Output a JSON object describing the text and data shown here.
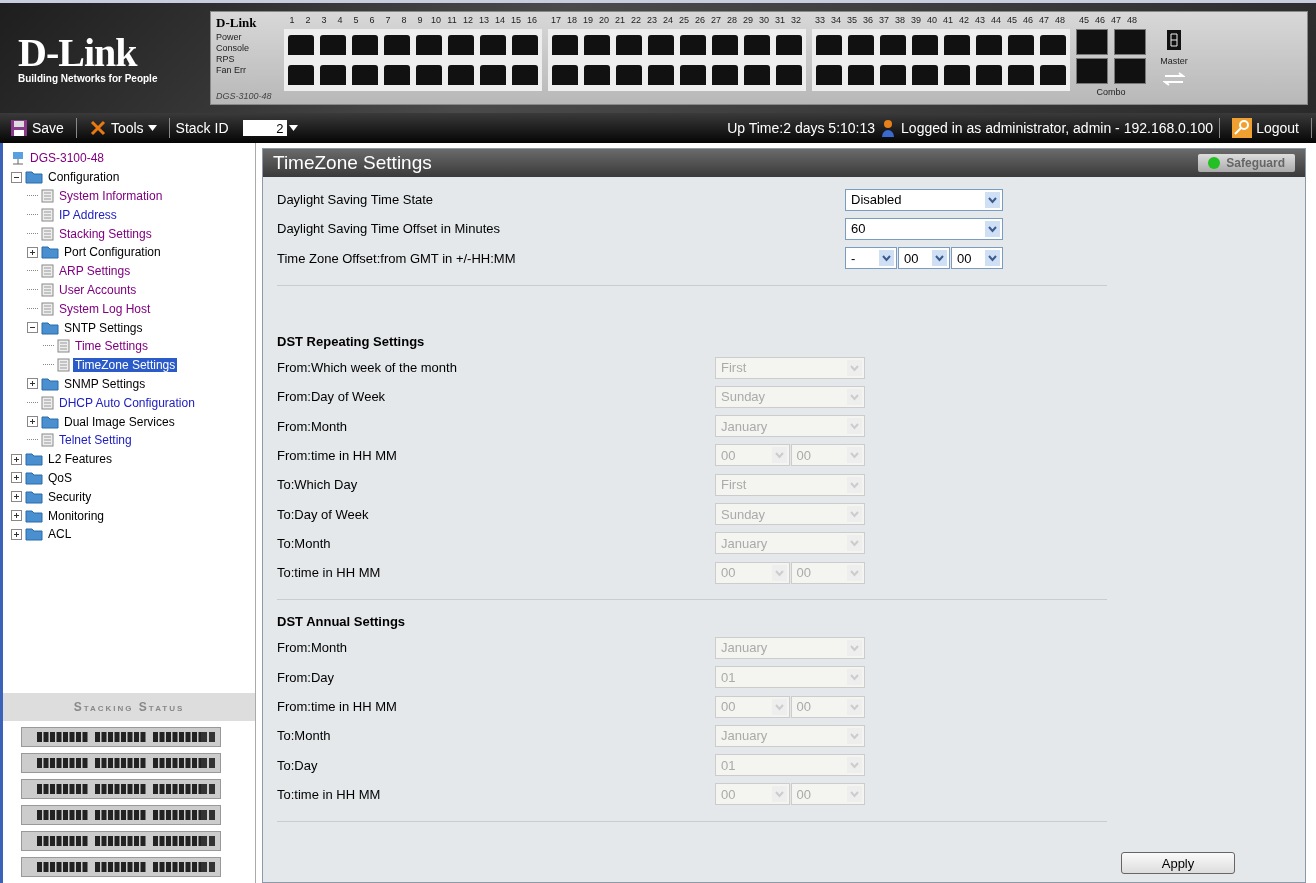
{
  "banner": {
    "logo": "D-Link",
    "tagline": "Building Networks for People",
    "device": {
      "brand": "D-Link",
      "model": "DGS-3100-48",
      "leds": [
        "Power",
        "Console",
        "RPS",
        "Fan Err"
      ],
      "ports": [
        "1",
        "2",
        "3",
        "4",
        "5",
        "6",
        "7",
        "8",
        "9",
        "10",
        "11",
        "12",
        "13",
        "14",
        "15",
        "16",
        "17",
        "18",
        "19",
        "20",
        "21",
        "22",
        "23",
        "24",
        "25",
        "26",
        "27",
        "28",
        "29",
        "30",
        "31",
        "32",
        "33",
        "34",
        "35",
        "36",
        "37",
        "38",
        "39",
        "40",
        "41",
        "42",
        "43",
        "44",
        "45",
        "46",
        "47",
        "48"
      ],
      "combo_ports": [
        "45",
        "46",
        "47",
        "48"
      ],
      "combo_label": "Combo",
      "master_label": "Master"
    }
  },
  "toolbar": {
    "save": "Save",
    "tools": "Tools",
    "stack_id_label": "Stack ID",
    "stack_id": "2",
    "uptime": "Up Time:2 days 5:10:13",
    "login": "Logged in as administrator, admin - 192.168.0.100",
    "logout": "Logout"
  },
  "tree": {
    "root": "DGS-3100-48",
    "items": [
      {
        "label": "Configuration",
        "kind": "folder",
        "expanded": true,
        "children": [
          {
            "label": "System Information",
            "kind": "page",
            "visited": true,
            "selected": false
          },
          {
            "label": "IP Address",
            "kind": "page",
            "visited": false,
            "selected": false
          },
          {
            "label": "Stacking Settings",
            "kind": "page",
            "visited": true,
            "selected": false
          },
          {
            "label": "Port Configuration",
            "kind": "folder",
            "expanded": false
          },
          {
            "label": "ARP Settings",
            "kind": "page",
            "visited": true,
            "selected": false
          },
          {
            "label": "User Accounts",
            "kind": "page",
            "visited": true,
            "selected": false
          },
          {
            "label": "System Log Host",
            "kind": "page",
            "visited": true,
            "selected": false
          },
          {
            "label": "SNTP Settings",
            "kind": "folder",
            "expanded": true,
            "children": [
              {
                "label": "Time Settings",
                "kind": "page",
                "visited": true,
                "selected": false
              },
              {
                "label": "TimeZone Settings",
                "kind": "page",
                "visited": true,
                "selected": true
              }
            ]
          },
          {
            "label": "SNMP Settings",
            "kind": "folder",
            "expanded": false
          },
          {
            "label": "DHCP Auto Configuration",
            "kind": "page",
            "visited": false,
            "selected": false
          },
          {
            "label": "Dual Image Services",
            "kind": "folder",
            "expanded": false
          },
          {
            "label": "Telnet Setting",
            "kind": "page",
            "visited": false,
            "selected": false
          }
        ]
      },
      {
        "label": "L2 Features",
        "kind": "folder",
        "expanded": false
      },
      {
        "label": "QoS",
        "kind": "folder",
        "expanded": false
      },
      {
        "label": "Security",
        "kind": "folder",
        "expanded": false
      },
      {
        "label": "Monitoring",
        "kind": "folder",
        "expanded": false
      },
      {
        "label": "ACL",
        "kind": "folder",
        "expanded": false
      }
    ]
  },
  "stacking_status": {
    "title": "Stacking Status"
  },
  "panel": {
    "title": "TimeZone Settings",
    "safeguard": "Safeguard",
    "safeguard_on": true,
    "sections": [
      {
        "rows": [
          {
            "label": "Daylight Saving Time State",
            "selects": [
              {
                "value": "Disabled",
                "disabled": false
              }
            ]
          },
          {
            "label": "Daylight Saving Time Offset in Minutes",
            "selects": [
              {
                "value": "60",
                "disabled": false
              }
            ]
          },
          {
            "label": "Time Zone Offset:from GMT in +/-HH:MM",
            "selects": [
              {
                "value": "-",
                "disabled": false
              },
              {
                "value": "00",
                "disabled": false
              },
              {
                "value": "00",
                "disabled": false
              }
            ]
          }
        ]
      },
      {
        "heading": "DST Repeating Settings",
        "rows": [
          {
            "label": "From:Which week of the month",
            "selects": [
              {
                "value": "First",
                "disabled": true
              }
            ]
          },
          {
            "label": "From:Day of Week",
            "selects": [
              {
                "value": "Sunday",
                "disabled": true
              }
            ]
          },
          {
            "label": "From:Month",
            "selects": [
              {
                "value": "January",
                "disabled": true
              }
            ]
          },
          {
            "label": "From:time in HH MM",
            "selects": [
              {
                "value": "00",
                "disabled": true
              },
              {
                "value": "00",
                "disabled": true
              }
            ]
          },
          {
            "label": "To:Which Day",
            "selects": [
              {
                "value": "First",
                "disabled": true
              }
            ]
          },
          {
            "label": "To:Day of Week",
            "selects": [
              {
                "value": "Sunday",
                "disabled": true
              }
            ]
          },
          {
            "label": "To:Month",
            "selects": [
              {
                "value": "January",
                "disabled": true
              }
            ]
          },
          {
            "label": "To:time in HH MM",
            "selects": [
              {
                "value": "00",
                "disabled": true
              },
              {
                "value": "00",
                "disabled": true
              }
            ]
          }
        ]
      },
      {
        "heading": "DST Annual Settings",
        "rows": [
          {
            "label": "From:Month",
            "selects": [
              {
                "value": "January",
                "disabled": true
              }
            ]
          },
          {
            "label": "From:Day",
            "selects": [
              {
                "value": "01",
                "disabled": true
              }
            ]
          },
          {
            "label": "From:time in HH MM",
            "selects": [
              {
                "value": "00",
                "disabled": true
              },
              {
                "value": "00",
                "disabled": true
              }
            ]
          },
          {
            "label": "To:Month",
            "selects": [
              {
                "value": "January",
                "disabled": true
              }
            ]
          },
          {
            "label": "To:Day",
            "selects": [
              {
                "value": "01",
                "disabled": true
              }
            ]
          },
          {
            "label": "To:time in HH MM",
            "selects": [
              {
                "value": "00",
                "disabled": true
              },
              {
                "value": "00",
                "disabled": true
              }
            ]
          }
        ]
      }
    ],
    "apply": "Apply"
  }
}
